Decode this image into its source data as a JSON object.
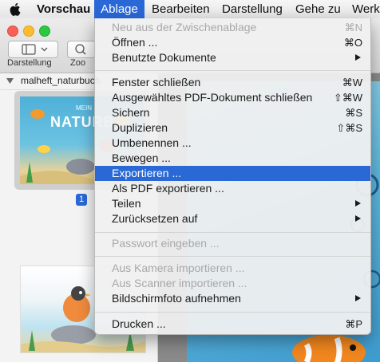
{
  "menubar": {
    "apple_icon": "apple-logo-icon",
    "app_name": "Vorschau",
    "items": [
      "Ablage",
      "Bearbeiten",
      "Darstellung",
      "Gehe zu",
      "Werk"
    ]
  },
  "toolbar": {
    "sidebar_label": "Darstellung",
    "zoom_label": "Zoo"
  },
  "sidebar": {
    "file_name": "malheft_naturbuch",
    "page_number": "1",
    "thumb_title": "NATURBU",
    "thumb_small": "MEIN"
  },
  "menu": {
    "items": [
      {
        "label": "Neu aus der Zwischenablage",
        "shortcut": "⌘N",
        "disabled": true
      },
      {
        "label": "Öffnen ...",
        "shortcut": "⌘O"
      },
      {
        "label": "Benutzte Dokumente",
        "submenu": true
      },
      {
        "label": "Fenster schließen",
        "shortcut": "⌘W"
      },
      {
        "label": "Ausgewähltes PDF-Dokument schließen",
        "shortcut": "⇧⌘W"
      },
      {
        "label": "Sichern",
        "shortcut": "⌘S"
      },
      {
        "label": "Duplizieren",
        "shortcut": "⇧⌘S"
      },
      {
        "label": "Umbenennen ..."
      },
      {
        "label": "Bewegen ..."
      },
      {
        "label": "Exportieren ...",
        "highlighted": true
      },
      {
        "label": "Als PDF exportieren ..."
      },
      {
        "label": "Teilen",
        "submenu": true
      },
      {
        "label": "Zurücksetzen auf",
        "submenu": true
      },
      {
        "label": "Passwort eingeben ...",
        "disabled": true
      },
      {
        "label": "Aus Kamera importieren ...",
        "disabled": true
      },
      {
        "label": "Aus Scanner importieren ...",
        "disabled": true
      },
      {
        "label": "Bildschirmfoto aufnehmen",
        "submenu": true
      },
      {
        "label": "Drucken ...",
        "shortcut": "⌘P"
      }
    ]
  }
}
